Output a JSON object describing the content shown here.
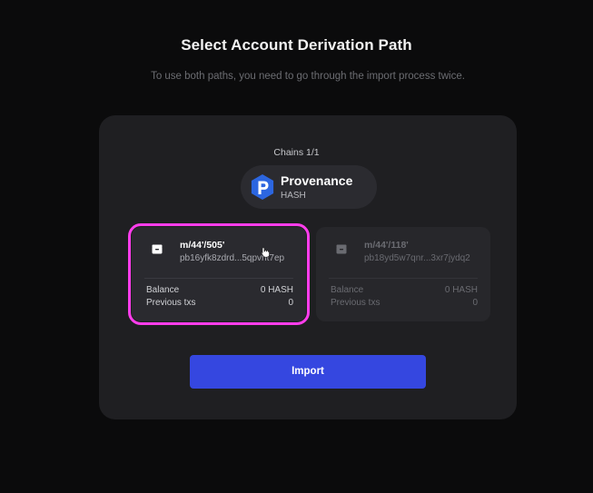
{
  "header": {
    "title": "Select Account Derivation Path",
    "subtitle": "To use both paths, you need to go through the import process twice."
  },
  "chains": {
    "label": "Chains 1/1",
    "selected": {
      "name": "Provenance",
      "ticker": "HASH",
      "icon": "provenance-logo-icon",
      "color": "#2c66e0"
    }
  },
  "accounts": [
    {
      "path": "m/44'/505'",
      "address": "pb16yfk8zdrd...5qpvht7ep",
      "balance_label": "Balance",
      "balance_value": "0 HASH",
      "txs_label": "Previous txs",
      "txs_value": "0",
      "selected": true,
      "icon": "wallet-icon"
    },
    {
      "path": "m/44'/118'",
      "address": "pb18yd5w7qnr...3xr7jydq2",
      "balance_label": "Balance",
      "balance_value": "0 HASH",
      "txs_label": "Previous txs",
      "txs_value": "0",
      "selected": false,
      "icon": "wallet-icon"
    }
  ],
  "actions": {
    "import_label": "Import"
  },
  "colors": {
    "background": "#0b0b0c",
    "card": "#1f1f22",
    "accent": "#3547e0",
    "highlight": "#ff3dec"
  }
}
